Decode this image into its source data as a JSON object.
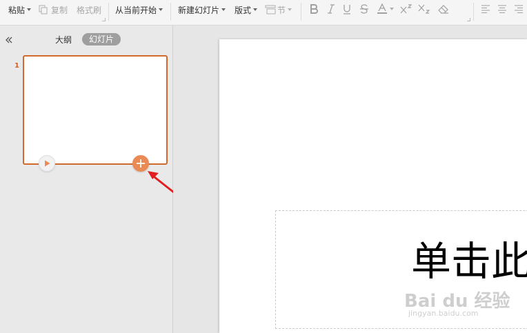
{
  "toolbar": {
    "paste": "粘贴",
    "copy": "复制",
    "format_painter": "格式刷",
    "from_current": "从当前开始",
    "new_slide": "新建幻灯片",
    "layout": "版式",
    "section": "节"
  },
  "left_panel": {
    "tab_outline": "大纲",
    "tab_slides": "幻灯片",
    "slide_number": "1"
  },
  "slide": {
    "title_placeholder": "单击此"
  },
  "watermark": {
    "main": "Bai du 经验",
    "sub": "jingyan.baidu.com"
  },
  "colors": {
    "accent": "#d2692c",
    "add_button": "#ea8a54",
    "arrow": "#e02020"
  },
  "icons": {
    "collapse": "double-chevron-left-icon",
    "play": "play-icon",
    "add": "plus-icon",
    "bold": "bold-icon",
    "italic": "italic-icon",
    "underline": "underline-icon",
    "strike": "strikethrough-icon",
    "font_color": "font-color-icon",
    "superscript": "superscript-icon",
    "subscript": "subscript-icon",
    "clear": "eraser-icon",
    "align_left": "align-left-icon",
    "align_center": "align-center-icon",
    "align_right": "align-right-icon"
  }
}
